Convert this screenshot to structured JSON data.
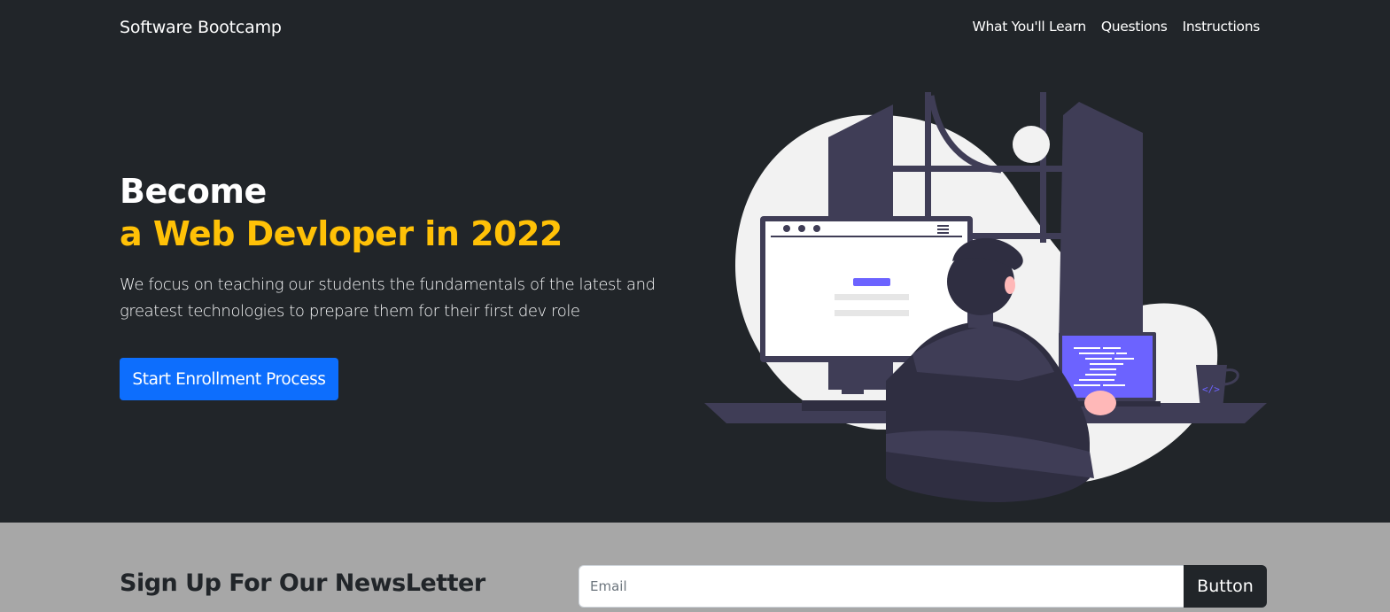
{
  "navbar": {
    "brand": "Software Bootcamp",
    "links": [
      {
        "label": "What You'll Learn"
      },
      {
        "label": "Questions"
      },
      {
        "label": "Instructions"
      }
    ]
  },
  "hero": {
    "title_line1": "Become",
    "title_line2": "a Web Devloper in 2022",
    "description": "We focus on teaching our students the fundamentals of the latest and greatest technologies to prepare them for their first dev role",
    "cta_label": "Start Enrollment Process",
    "illustration_icon": "developer-at-computer-illustration"
  },
  "newsletter": {
    "title": "Sign Up For Our NewsLetter",
    "email_placeholder": "Email",
    "email_value": "",
    "button_label": "Button"
  },
  "colors": {
    "dark_bg": "#212529",
    "accent_yellow": "#ffc107",
    "primary_blue": "#0d6efd",
    "newsletter_bg": "#a7a7a7",
    "illustration_purple": "#6c63ff"
  }
}
